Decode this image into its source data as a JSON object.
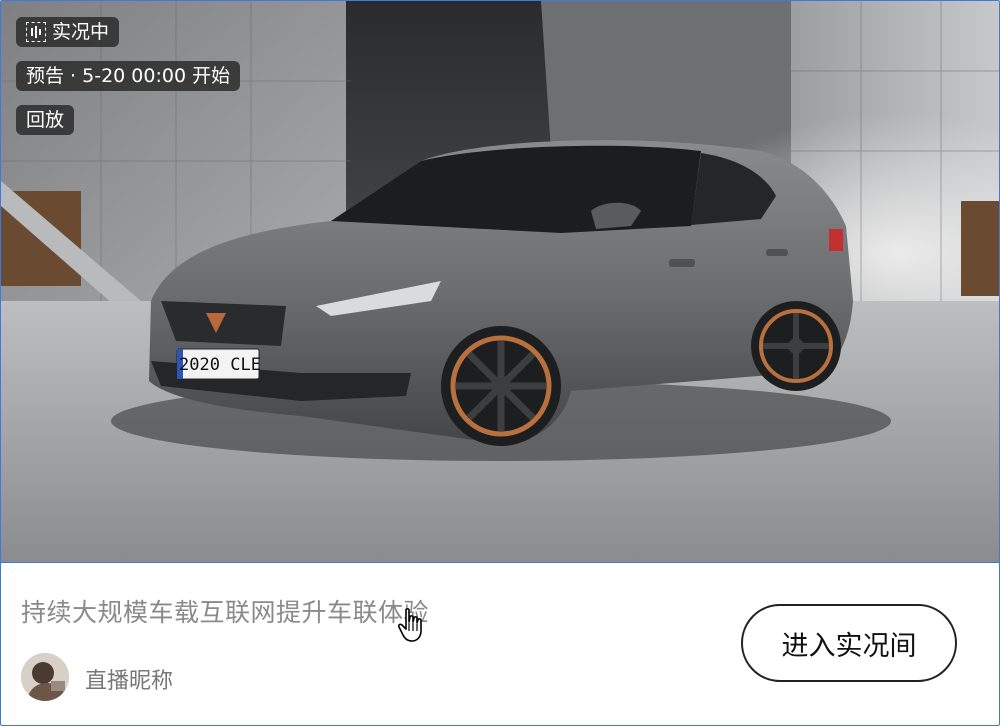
{
  "badges": {
    "live": "实况中",
    "preview": "预告 · 5-20 00:00 开始",
    "replay": "回放"
  },
  "media": {
    "plate_text": "2020 CLE"
  },
  "card": {
    "title": "持续大规模车载互联网提升车联体验",
    "nickname": "直播昵称",
    "enter_button": "进入实况间"
  },
  "icons": {
    "live": "live-sound-icon",
    "cursor": "hand-pointer-icon"
  },
  "colors": {
    "border_accent": "#3c7ae0",
    "badge_bg": "#282828"
  }
}
